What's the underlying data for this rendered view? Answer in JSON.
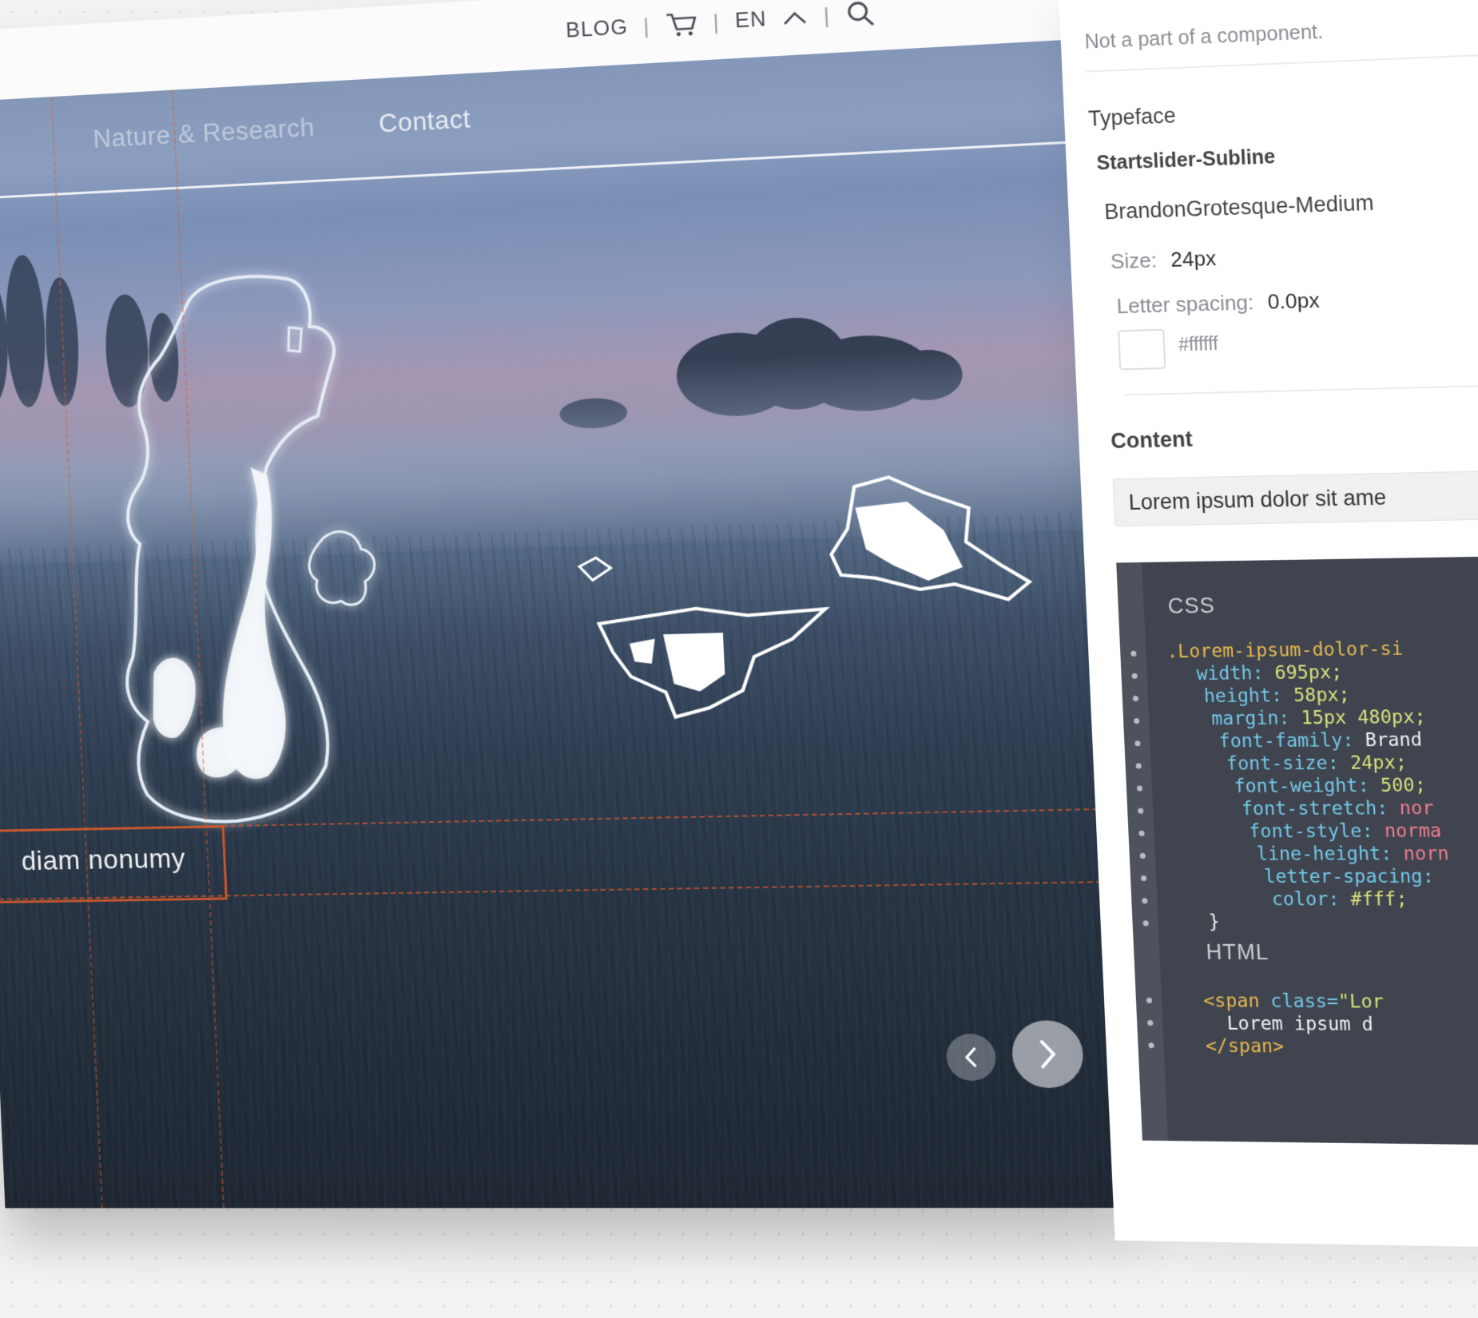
{
  "site": {
    "topbar": {
      "blog": "BLOG",
      "separator": "|",
      "language": "EN",
      "icons": [
        "cart-icon",
        "chevron-up-icon",
        "search-icon"
      ]
    },
    "nav": {
      "items": [
        "Nature & Research",
        "Contact"
      ]
    },
    "hero": {
      "subline_text": "diam nonumy"
    },
    "slider": {
      "icons": [
        "chevron-left-icon",
        "chevron-right-icon"
      ]
    }
  },
  "inspector": {
    "note": "Not a part of a component.",
    "typeface_heading": "Typeface",
    "style_name": "Startslider-Subline",
    "font_name": "BrandonGrotesque-Medium",
    "size_label": "Size:",
    "size_value": "24px",
    "spacing_label": "Letter spacing:",
    "spacing_value": "0.0px",
    "color_hex": "#ffffff",
    "content_heading": "Content",
    "content_value": "Lorem ipsum dolor sit ame",
    "css_heading": "CSS",
    "html_heading": "HTML",
    "css_lines": [
      {
        "k": ".Lorem-ipsum-dolor-si",
        "v": ""
      },
      {
        "k": "width",
        "v": "695px",
        "t": "num"
      },
      {
        "k": "height",
        "v": "58px",
        "t": "num"
      },
      {
        "k": "margin",
        "v": "15px 480px",
        "t": "num"
      },
      {
        "k": "font-family",
        "v": "Brand",
        "t": "txt"
      },
      {
        "k": "font-size",
        "v": "24px",
        "t": "num"
      },
      {
        "k": "font-weight",
        "v": "500",
        "t": "num"
      },
      {
        "k": "font-stretch",
        "v": "nor",
        "t": "kw"
      },
      {
        "k": "font-style",
        "v": "norma",
        "t": "kw"
      },
      {
        "k": "line-height",
        "v": "norn",
        "t": "kw"
      },
      {
        "k": "letter-spacing",
        "v": "",
        "t": "num"
      },
      {
        "k": "color",
        "v": "#fff",
        "t": "num"
      }
    ],
    "css_close": "}",
    "html_lines": {
      "open_tag": "<span",
      "attr": "class=",
      "attr_value": "\"Lor",
      "inner": "Lorem ipsum d",
      "close_tag": "</span>"
    }
  },
  "colors": {
    "guide": "#dc5a28",
    "code_bg": "#3f444f",
    "code_selector": "#e6b84d",
    "code_property": "#73c8e8",
    "code_number": "#d9e07a",
    "code_keyword": "#ef7d8e"
  }
}
